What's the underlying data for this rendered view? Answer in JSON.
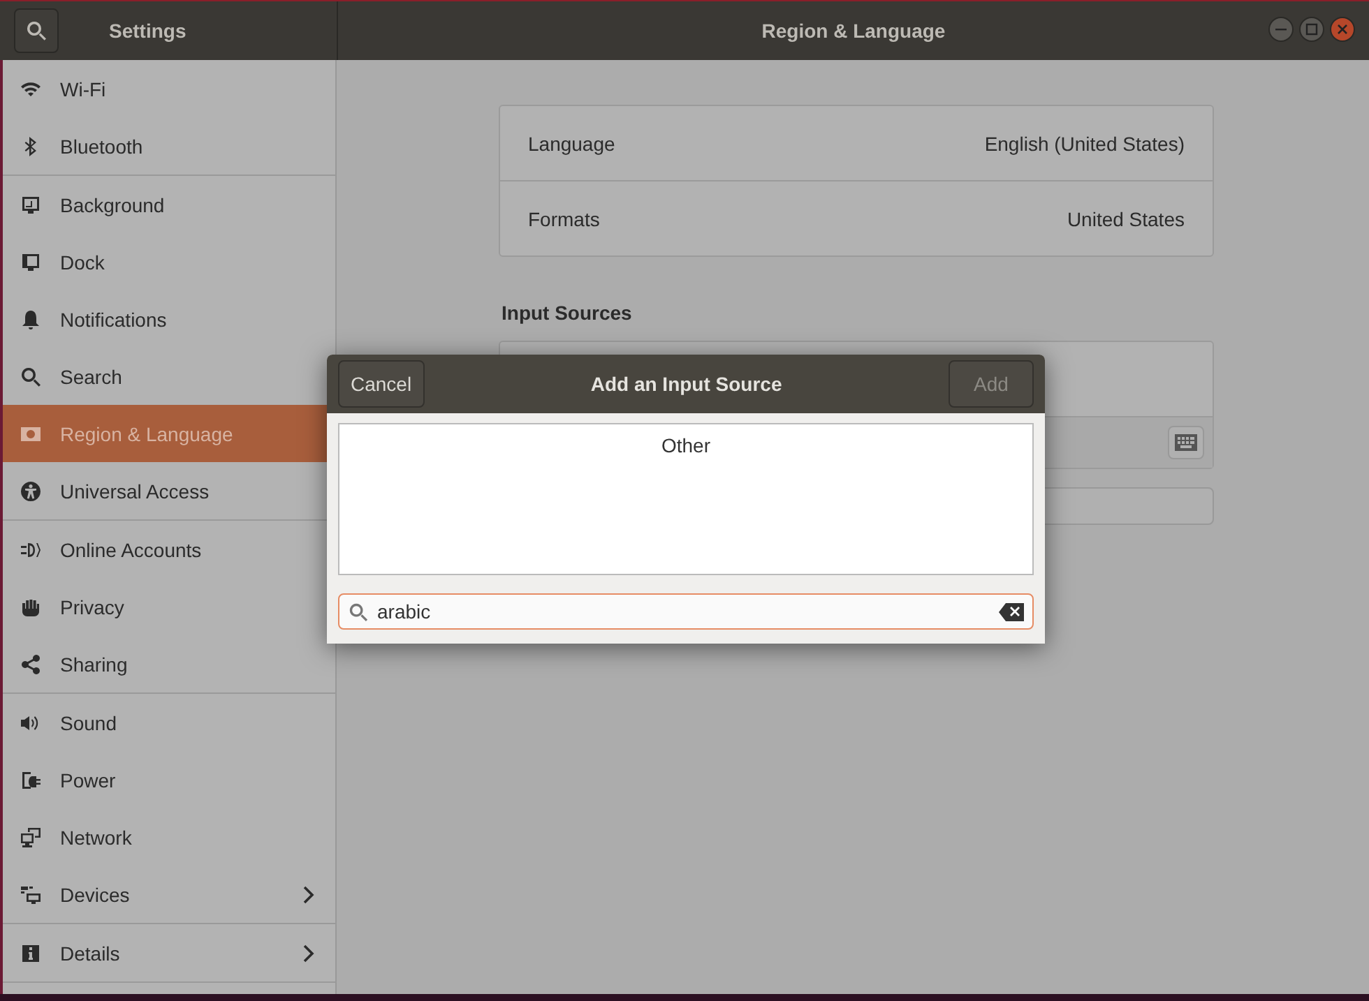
{
  "window": {
    "sidebar_title": "Settings",
    "title": "Region & Language"
  },
  "sidebar": {
    "groups": [
      [
        {
          "label": "Wi-Fi",
          "selected": false,
          "chevron": false
        },
        {
          "label": "Bluetooth",
          "selected": false,
          "chevron": false
        }
      ],
      [
        {
          "label": "Background",
          "selected": false,
          "chevron": false
        },
        {
          "label": "Dock",
          "selected": false,
          "chevron": false
        },
        {
          "label": "Notifications",
          "selected": false,
          "chevron": false
        },
        {
          "label": "Search",
          "selected": false,
          "chevron": false
        },
        {
          "label": "Region & Language",
          "selected": true,
          "chevron": false
        },
        {
          "label": "Universal Access",
          "selected": false,
          "chevron": false
        }
      ],
      [
        {
          "label": "Online Accounts",
          "selected": false,
          "chevron": false
        },
        {
          "label": "Privacy",
          "selected": false,
          "chevron": false
        },
        {
          "label": "Sharing",
          "selected": false,
          "chevron": false
        }
      ],
      [
        {
          "label": "Sound",
          "selected": false,
          "chevron": false
        },
        {
          "label": "Power",
          "selected": false,
          "chevron": false
        },
        {
          "label": "Network",
          "selected": false,
          "chevron": false
        },
        {
          "label": "Devices",
          "selected": false,
          "chevron": true
        }
      ],
      [
        {
          "label": "Details",
          "selected": false,
          "chevron": true
        }
      ]
    ]
  },
  "content": {
    "rows": [
      {
        "label": "Language",
        "value": "English (United States)"
      },
      {
        "label": "Formats",
        "value": "United States"
      }
    ],
    "input_sources_heading": "Input Sources"
  },
  "dialog": {
    "cancel": "Cancel",
    "title": "Add an Input Source",
    "add": {
      "label": "Add",
      "disabled": true
    },
    "list": [
      {
        "label": "Other"
      }
    ],
    "search": {
      "value": "arabic"
    }
  }
}
